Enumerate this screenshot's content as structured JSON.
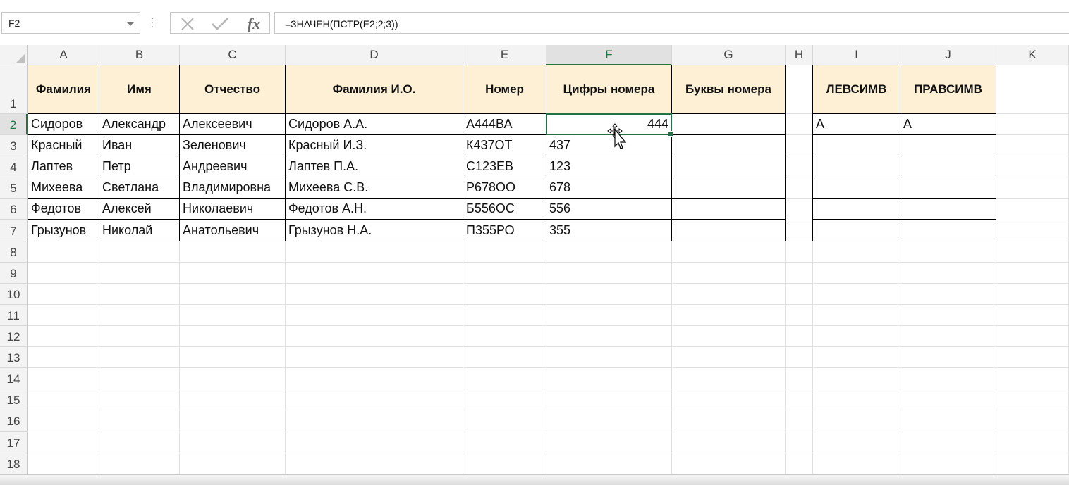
{
  "name_box": "F2",
  "formula": "=ЗНАЧЕН(ПСТР(E2;2;3))",
  "formula_buttons": {
    "fx_label": "fx"
  },
  "columns": [
    "A",
    "B",
    "C",
    "D",
    "E",
    "F",
    "G",
    "H",
    "I",
    "J",
    "K"
  ],
  "selected_column": "F",
  "rows": [
    "1",
    "2",
    "3",
    "4",
    "5",
    "6",
    "7",
    "8",
    "9",
    "10",
    "11",
    "12",
    "13",
    "14",
    "15",
    "16",
    "17",
    "18"
  ],
  "selected_row": "2",
  "headers": {
    "A": "Фамилия",
    "B": "Имя",
    "C": "Отчество",
    "D": "Фамилия И.О.",
    "E": "Номер",
    "F": "Цифры номера",
    "G": "Буквы номера",
    "I": "ЛЕВСИМВ",
    "J": "ПРАВСИМВ"
  },
  "table_rows": [
    {
      "A": "Сидоров",
      "B": "Александр",
      "C": "Алексеевич",
      "D": "Сидоров А.А.",
      "E": "А444ВА",
      "F": "444",
      "G": "",
      "I": "А",
      "J": "А"
    },
    {
      "A": "Красный",
      "B": "Иван",
      "C": "Зеленович",
      "D": "Красный И.З.",
      "E": "К437ОТ",
      "F": "437",
      "G": "",
      "I": "",
      "J": ""
    },
    {
      "A": "Лаптев",
      "B": "Петр",
      "C": "Андреевич",
      "D": "Лаптев П.А.",
      "E": "С123ЕВ",
      "F": "123",
      "G": "",
      "I": "",
      "J": ""
    },
    {
      "A": "Михеева",
      "B": "Светлана",
      "C": "Владимировна",
      "D": "Михеева С.В.",
      "E": "Р678ОО",
      "F": "678",
      "G": "",
      "I": "",
      "J": ""
    },
    {
      "A": "Федотов",
      "B": "Алексей",
      "C": "Николаевич",
      "D": "Федотов А.Н.",
      "E": "Б556ОС",
      "F": "556",
      "G": "",
      "I": "",
      "J": ""
    },
    {
      "A": "Грызунов",
      "B": "Николай",
      "C": "Анатольевич",
      "D": "Грызунов Н.А.",
      "E": "П355РО",
      "F": "355",
      "G": "",
      "I": "",
      "J": ""
    }
  ],
  "colors": {
    "accent": "#217346",
    "header_fill": "#fdf0d5"
  },
  "icons": {
    "cancel": "close-icon",
    "enter": "check-icon",
    "function": "fx-icon",
    "cursor": "move-cursor-icon"
  }
}
